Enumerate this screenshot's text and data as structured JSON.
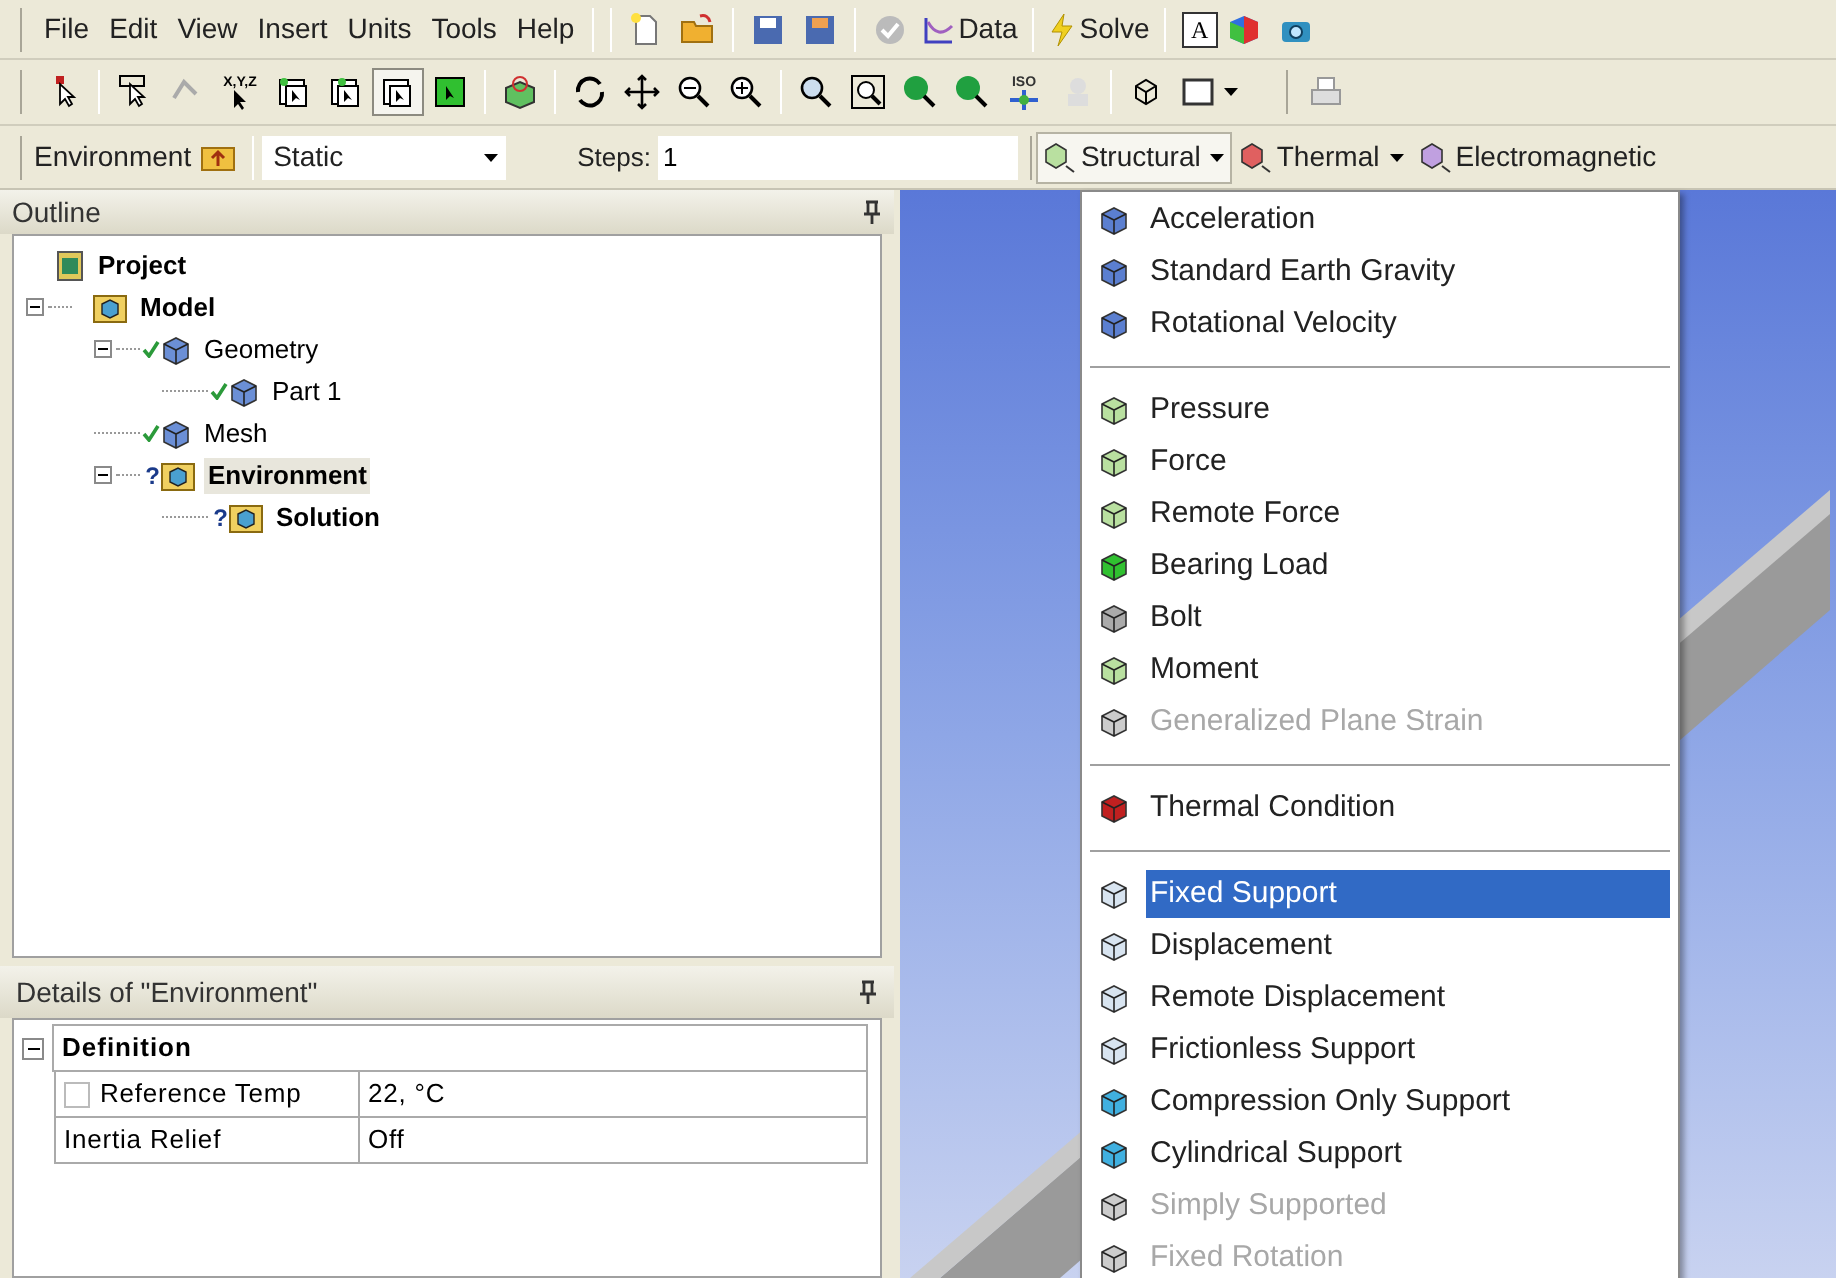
{
  "menu_bar": {
    "items": [
      "File",
      "Edit",
      "View",
      "Insert",
      "Units",
      "Tools",
      "Help"
    ]
  },
  "toolbar": {
    "buttons": [
      {
        "label": "Data"
      },
      {
        "label": "Solve"
      }
    ],
    "annotation_glyph": "A"
  },
  "graphics_toolbar": {
    "coordinate_glyph": "X,Y,Z",
    "iso_glyph": "ISO"
  },
  "context_toolbar": {
    "title": "Environment",
    "analysis_type": "Static",
    "steps_label": "Steps:",
    "steps_value": "1",
    "load_menus": [
      {
        "label": "Structural",
        "selected": true
      },
      {
        "label": "Thermal",
        "selected": false
      },
      {
        "label": "Electromagnetic",
        "selected": false
      }
    ]
  },
  "outline": {
    "title": "Outline",
    "tree": [
      {
        "label": "Project",
        "bold": true,
        "tick": false,
        "selected": false,
        "children": [
          {
            "label": "Model",
            "bold": true,
            "tick": false,
            "expanded": true,
            "selected": false,
            "children": [
              {
                "label": "Geometry",
                "bold": false,
                "tick": true,
                "expanded": true,
                "selected": false,
                "children": [
                  {
                    "label": "Part 1",
                    "bold": false,
                    "tick": true,
                    "selected": false
                  }
                ]
              },
              {
                "label": "Mesh",
                "bold": false,
                "tick": true,
                "selected": false
              },
              {
                "label": "Environment",
                "bold": true,
                "tick": false,
                "status_glyph": "?",
                "expanded": true,
                "selected": true,
                "children": [
                  {
                    "label": "Solution",
                    "bold": true,
                    "tick": false,
                    "status_glyph": "?",
                    "selected": false
                  }
                ]
              }
            ]
          }
        ]
      }
    ]
  },
  "details": {
    "title": "Details of \"Environment\"",
    "groups": [
      {
        "label": "Definition",
        "expanded": true,
        "rows": [
          {
            "kind": "checkbox",
            "name": "Reference Temp",
            "value": "22, °C",
            "checked": false
          },
          {
            "kind": "plain",
            "name": "Inertia Relief",
            "value": "Off"
          }
        ]
      }
    ]
  },
  "structural_menu": {
    "items": [
      {
        "kind": "item",
        "label": "Acceleration",
        "disabled": false,
        "selected": false
      },
      {
        "kind": "item",
        "label": "Standard Earth Gravity",
        "disabled": false,
        "selected": false
      },
      {
        "kind": "item",
        "label": "Rotational Velocity",
        "disabled": false,
        "selected": false
      },
      {
        "kind": "separator"
      },
      {
        "kind": "item",
        "label": "Pressure",
        "disabled": false,
        "selected": false
      },
      {
        "kind": "item",
        "label": "Force",
        "disabled": false,
        "selected": false
      },
      {
        "kind": "item",
        "label": "Remote Force",
        "disabled": false,
        "selected": false
      },
      {
        "kind": "item",
        "label": "Bearing Load",
        "disabled": false,
        "selected": false
      },
      {
        "kind": "item",
        "label": "Bolt",
        "disabled": false,
        "selected": false
      },
      {
        "kind": "item",
        "label": "Moment",
        "disabled": false,
        "selected": false
      },
      {
        "kind": "item",
        "label": "Generalized Plane Strain",
        "disabled": true,
        "selected": false
      },
      {
        "kind": "separator"
      },
      {
        "kind": "item",
        "label": "Thermal Condition",
        "disabled": false,
        "selected": false
      },
      {
        "kind": "separator"
      },
      {
        "kind": "item",
        "label": "Fixed Support",
        "disabled": false,
        "selected": true
      },
      {
        "kind": "item",
        "label": "Displacement",
        "disabled": false,
        "selected": false
      },
      {
        "kind": "item",
        "label": "Remote Displacement",
        "disabled": false,
        "selected": false
      },
      {
        "kind": "item",
        "label": "Frictionless Support",
        "disabled": false,
        "selected": false
      },
      {
        "kind": "item",
        "label": "Compression Only Support",
        "disabled": false,
        "selected": false
      },
      {
        "kind": "item",
        "label": "Cylindrical Support",
        "disabled": false,
        "selected": false
      },
      {
        "kind": "item",
        "label": "Simply Supported",
        "disabled": true,
        "selected": false
      },
      {
        "kind": "item",
        "label": "Fixed Rotation",
        "disabled": true,
        "selected": false
      }
    ]
  }
}
